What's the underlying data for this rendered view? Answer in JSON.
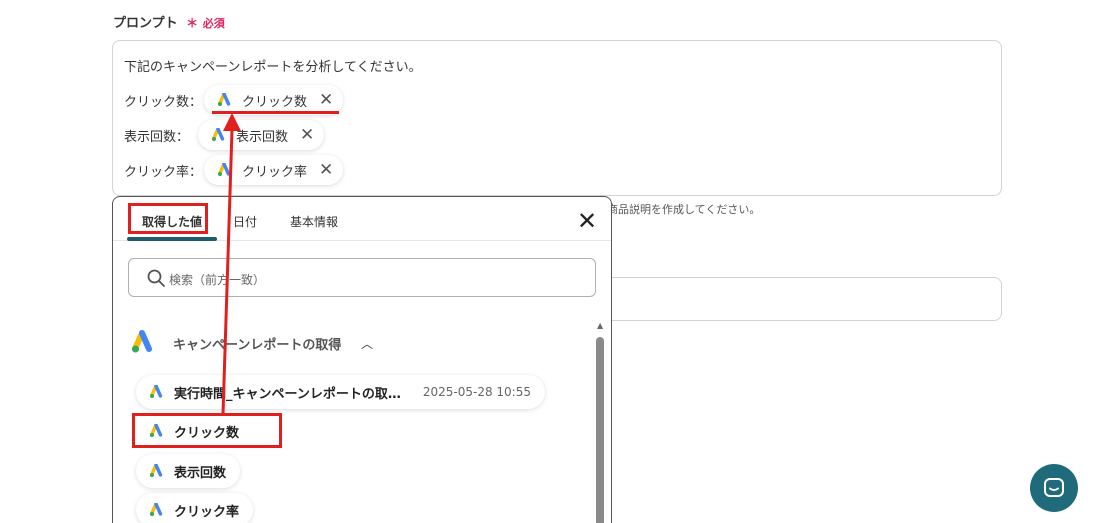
{
  "field": {
    "label": "プロンプト",
    "required_mark": "＊",
    "required_text": "必須"
  },
  "prompt": {
    "line1": "下記のキャンペーンレポートを分析してください。",
    "rows": [
      {
        "label": "クリック数：",
        "chip": "クリック数"
      },
      {
        "label": "表示回数：",
        "chip": "表示回数"
      },
      {
        "label": "クリック率：",
        "chip": "クリック率"
      }
    ],
    "hint": "商品説明を作成してください。"
  },
  "panel": {
    "tabs": [
      "取得した値",
      "日付",
      "基本情報"
    ],
    "search_placeholder": "検索（前方一致）",
    "group_title": "キャンペーンレポートの取得",
    "items": [
      {
        "label": "実行時間_キャンペーンレポートの取…",
        "date": "2025-05-28 10:55"
      },
      {
        "label": "クリック数"
      },
      {
        "label": "表示回数"
      },
      {
        "label": "クリック率"
      }
    ]
  },
  "colors": {
    "accent": "#1f6b7b",
    "required": "#e0245e",
    "annotation": "#e0201e"
  },
  "icons": {
    "ads": "google-ads-icon",
    "close": "close-icon",
    "search": "search-icon",
    "chevron": "chevron-up-icon",
    "chat": "chat-icon"
  }
}
